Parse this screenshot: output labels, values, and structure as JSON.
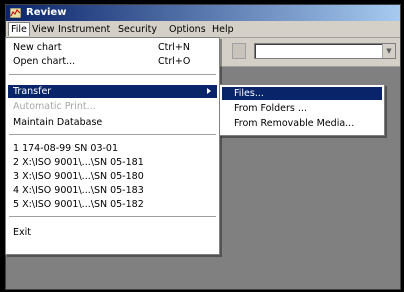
{
  "window": {
    "title": "Review",
    "icon": "app-icon"
  },
  "menubar": {
    "items": [
      "File",
      "View",
      "Instrument",
      "Security",
      "Options",
      "Help"
    ]
  },
  "toolbar": {
    "button_icon": "toolbar-icon",
    "combo_value": "",
    "combo_dropdown_icon": "chevron-down-icon"
  },
  "file_menu": {
    "new_chart": {
      "label": "New chart",
      "shortcut": "Ctrl+N"
    },
    "open_chart": {
      "label": "Open chart...",
      "shortcut": "Ctrl+O"
    },
    "transfer": {
      "label": "Transfer"
    },
    "automatic_print": {
      "label": "Automatic Print..."
    },
    "maintain_database": {
      "label": "Maintain Database"
    },
    "recent": [
      "1 174-08-99 SN 03-01",
      "2 X:\\ISO 9001\\...\\SN 05-181",
      "3 X:\\ISO 9001\\...\\SN 05-180",
      "4 X:\\ISO 9001\\...\\SN 05-183",
      "5 X:\\ISO 9001\\...\\SN 05-182"
    ],
    "exit": {
      "label": "Exit"
    }
  },
  "transfer_submenu": {
    "items": [
      "Files...",
      "From Folders ...",
      "From Removable Media..."
    ]
  },
  "colors": {
    "highlight": "#0a246a",
    "menu_bg": "#ffffff",
    "workspace": "#808080",
    "chrome": "#d4d0c8"
  }
}
